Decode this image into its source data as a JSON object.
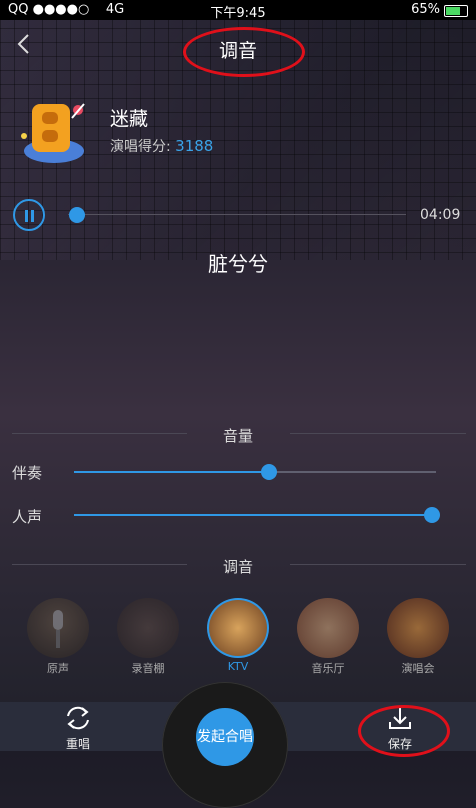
{
  "status_bar": {
    "carrier": "QQ ●●●●○",
    "network": "4G",
    "time": "下午9:45",
    "battery": "65%"
  },
  "header": {
    "back_icon": "chevron-left-icon",
    "title": "调音"
  },
  "song": {
    "name": "迷藏",
    "score_label": "演唱得分:",
    "score": "3188"
  },
  "player": {
    "duration": "04:09",
    "progress": 0.03,
    "lyric": "脏兮兮"
  },
  "volume": {
    "section_title": "音量",
    "accompaniment_label": "伴奏",
    "accompaniment_level": 0.54,
    "vocal_label": "人声",
    "vocal_level": 0.99
  },
  "tuning": {
    "section_title": "调音",
    "effects": [
      {
        "label": "原声",
        "selected": false
      },
      {
        "label": "录音棚",
        "selected": false
      },
      {
        "label": "KTV",
        "selected": true
      },
      {
        "label": "音乐厅",
        "selected": false
      },
      {
        "label": "演唱会",
        "selected": false
      }
    ]
  },
  "bottom_bar": {
    "redo_label": "重唱",
    "record_label": "发起合唱",
    "save_label": "保存"
  },
  "colors": {
    "accent": "#2f98e6",
    "annotation": "#e0101a"
  }
}
